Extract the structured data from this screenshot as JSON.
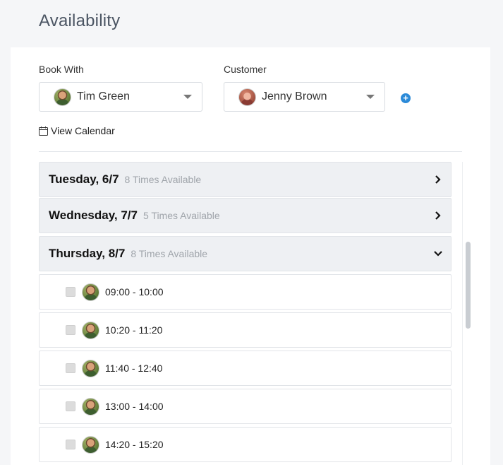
{
  "page": {
    "title": "Availability"
  },
  "book_with": {
    "label": "Book With",
    "value": "Tim Green",
    "avatar": "person-avatar"
  },
  "customer": {
    "label": "Customer",
    "value": "Jenny Brown",
    "avatar": "person-avatar"
  },
  "add_icon": "plus-circle-icon",
  "view_calendar": {
    "label": "View Calendar",
    "icon": "calendar-icon"
  },
  "colors": {
    "accent": "#2b8ad8",
    "day_header_bg": "#eef0f3",
    "muted_text": "#a0a5ab"
  },
  "days": [
    {
      "name": "Tuesday, 6/7",
      "count": "8 Times Available",
      "expanded": false
    },
    {
      "name": "Wednesday, 7/7",
      "count": "5 Times Available",
      "expanded": false
    },
    {
      "name": "Thursday, 8/7",
      "count": "8 Times Available",
      "expanded": true
    }
  ],
  "slots": [
    {
      "time": "09:00 - 10:00",
      "checked": false
    },
    {
      "time": "10:20 - 11:20",
      "checked": false
    },
    {
      "time": "11:40 - 12:40",
      "checked": false
    },
    {
      "time": "13:00 - 14:00",
      "checked": false
    },
    {
      "time": "14:20 - 15:20",
      "checked": false
    }
  ]
}
